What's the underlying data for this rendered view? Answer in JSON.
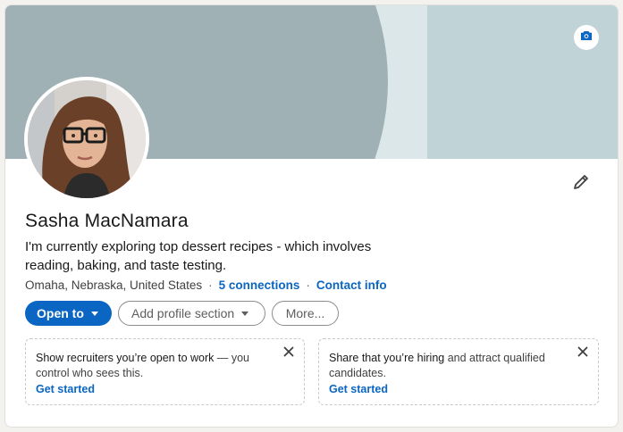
{
  "profile": {
    "name": "Sasha MacNamara",
    "headline": "I'm currently exploring top dessert recipes - which involves reading, baking, and taste testing.",
    "location": "Omaha, Nebraska, United States",
    "separator": "·",
    "connections": "5 connections",
    "contact_info": "Contact info"
  },
  "actions": {
    "open_to": "Open to",
    "add_section": "Add profile section",
    "more": "More..."
  },
  "promos": [
    {
      "bold": "Show recruiters you’re open to work",
      "rest": " — you control who sees this.",
      "cta": "Get started"
    },
    {
      "bold": "Share that you’re hiring",
      "rest": " and attract qualified candidates.",
      "cta": "Get started"
    }
  ],
  "icons": {
    "cover_camera": "camera-icon",
    "edit": "pencil-icon",
    "close": "close-icon",
    "dropdown": "caret-down-icon"
  },
  "colors": {
    "brand_blue": "#0a66c2",
    "banner_light": "#c0d3d6",
    "banner_dark": "#9fb1b5"
  }
}
